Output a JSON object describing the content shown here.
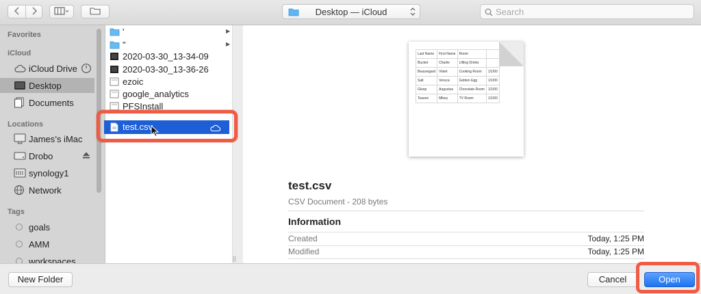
{
  "toolbar": {
    "back_icon": "chevron-left-icon",
    "forward_icon": "chevron-right-icon",
    "view_icon": "column-view-icon",
    "new_folder_icon": "new-folder-icon",
    "location": "Desktop — iCloud",
    "search_placeholder": "Search"
  },
  "sidebar": {
    "favorites_header": "Favorites",
    "icloud_header": "iCloud",
    "icloud_items": [
      {
        "label": "iCloud Drive",
        "icon": "cloud-icon"
      },
      {
        "label": "Desktop",
        "icon": "desktop-icon",
        "selected": true
      },
      {
        "label": "Documents",
        "icon": "documents-icon"
      }
    ],
    "locations_header": "Locations",
    "location_items": [
      {
        "label": "James’s iMac",
        "icon": "imac-icon"
      },
      {
        "label": "Drobo",
        "icon": "drive-icon"
      },
      {
        "label": "synology1",
        "icon": "server-icon"
      },
      {
        "label": "Network",
        "icon": "network-icon"
      }
    ],
    "tags_header": "Tags",
    "tag_items": [
      {
        "label": "goals"
      },
      {
        "label": "AMM"
      },
      {
        "label": "workspaces"
      }
    ]
  },
  "files": [
    {
      "name": "'",
      "type": "folder"
    },
    {
      "name": "\"",
      "type": "folder"
    },
    {
      "name": "2020-03-30_13-34-09",
      "type": "video"
    },
    {
      "name": "2020-03-30_13-36-26",
      "type": "video"
    },
    {
      "name": "ezoic",
      "type": "file"
    },
    {
      "name": "google_analytics",
      "type": "file"
    },
    {
      "name": "PFSInstall",
      "type": "file"
    }
  ],
  "selected_file": {
    "name": "test.csv",
    "icon": "csv-file-icon",
    "status_icon": "icloud-icon"
  },
  "preview": {
    "table": [
      [
        "Last Name",
        "First Name",
        "Room",
        ""
      ],
      [
        "Bucket",
        "Charlie",
        "Lifting Drinks",
        ""
      ],
      [
        "Beauregard",
        "Violet",
        "Cooking Room",
        "1/1/00"
      ],
      [
        "Salt",
        "Veruca",
        "Golden Egg",
        "1/1/00"
      ],
      [
        "Gloop",
        "Augustus",
        "Chocolate Room",
        "1/1/00"
      ],
      [
        "Teavee",
        "Mikey",
        "TV Room",
        "1/1/00"
      ]
    ],
    "title": "test.csv",
    "subtitle": "CSV Document - 208 bytes",
    "info_header": "Information",
    "created_label": "Created",
    "created_value": "Today, 1:25 PM",
    "modified_label": "Modified",
    "modified_value": "Today, 1:25 PM"
  },
  "footer": {
    "new_folder": "New Folder",
    "cancel": "Cancel",
    "open": "Open"
  },
  "colors": {
    "selection": "#1e5fd6",
    "highlight": "#f15a43",
    "primary_button": "#1f73f0"
  }
}
